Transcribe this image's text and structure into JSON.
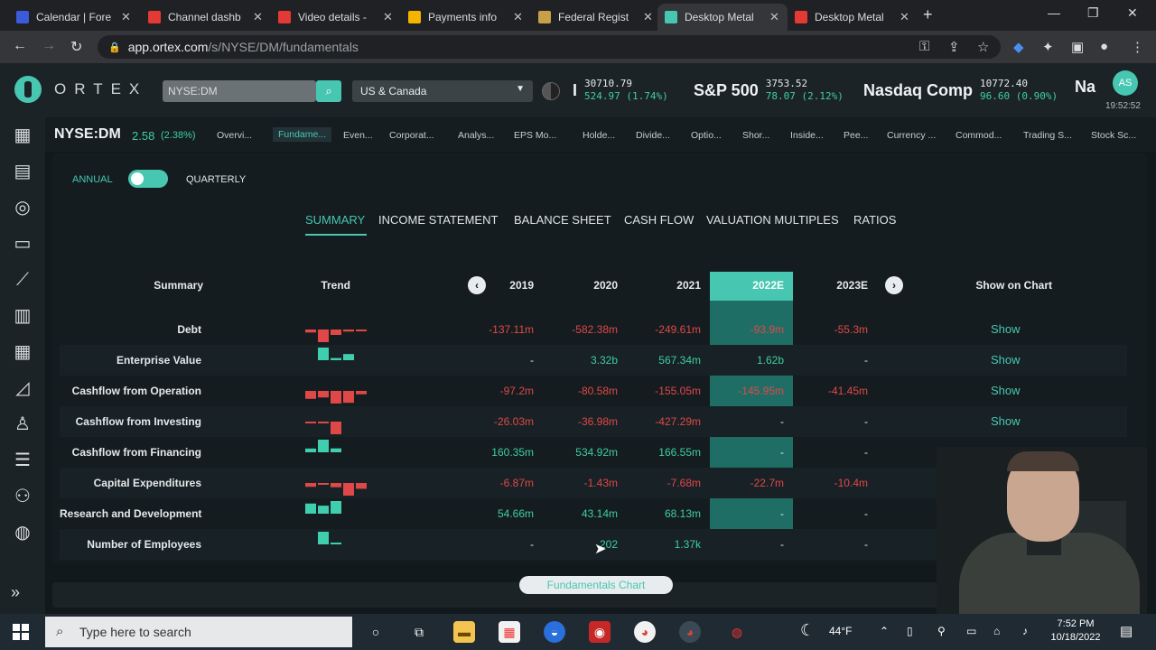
{
  "browser": {
    "tabs": [
      {
        "label": "Calendar | Fore",
        "color": "#3b5bdb"
      },
      {
        "label": "Channel dashb",
        "color": "#e53935"
      },
      {
        "label": "Video details -",
        "color": "#e53935"
      },
      {
        "label": "Payments info",
        "color": "#f4b400"
      },
      {
        "label": "Federal Regist",
        "color": "#c8a04a"
      },
      {
        "label": "Desktop Metal",
        "color": "#47c7b2"
      },
      {
        "label": "Desktop Metal",
        "color": "#e53935"
      }
    ],
    "active_tab": 5,
    "url_host": "app.ortex.com",
    "url_path": "/s/NYSE/DM/fundamentals"
  },
  "header": {
    "logo_text": "ORTEX",
    "search_value": "NYSE:DM",
    "region": "US & Canada",
    "tickers": [
      {
        "name": "I",
        "v1": "30710.79",
        "v2": "524.97 (1.74%)"
      },
      {
        "name": "S&P 500",
        "v1": "3753.52",
        "v2": "78.07 (2.12%)"
      },
      {
        "name": "Nasdaq Comp",
        "v1": "10772.40",
        "v2": "96.60 (0.90%)"
      },
      {
        "name": "Na",
        "v1": "",
        "v2": ""
      }
    ],
    "avatar": "AS",
    "clock": "19:52:52"
  },
  "instrument": {
    "symbol": "NYSE:DM",
    "price": "2.58",
    "change": "(2.38%)",
    "tabs": [
      "Overvi...",
      "Fundame...",
      "Even...",
      "Corporat...",
      "Analys...",
      "EPS Mo...",
      "Holde...",
      "Divide...",
      "Optio...",
      "Shor...",
      "Inside...",
      "Pee...",
      "Currency ...",
      "Commod...",
      "Trading S...",
      "Stock Sc..."
    ]
  },
  "fundamentals": {
    "annual_label": "ANNUAL",
    "quarterly_label": "QUARTERLY",
    "subtabs": [
      "SUMMARY",
      "INCOME STATEMENT",
      "BALANCE SHEET",
      "CASH FLOW",
      "VALUATION MULTIPLES",
      "RATIOS"
    ],
    "col_summary": "Summary",
    "col_trend": "Trend",
    "years": [
      "2019",
      "2020",
      "2021",
      "2022E",
      "2023E"
    ],
    "col_show": "Show on Chart",
    "show_label": "Show",
    "rows": [
      {
        "label": "Debt",
        "values": [
          "-137.11m",
          "-582.38m",
          "-249.61m",
          "-93.9m",
          "-55.3m"
        ],
        "signs": [
          "neg",
          "neg",
          "neg",
          "neg",
          "neg"
        ]
      },
      {
        "label": "Enterprise Value",
        "values": [
          "-",
          "3.32b",
          "567.34m",
          "1.62b",
          "-"
        ],
        "signs": [
          "neu",
          "pos",
          "pos",
          "pos",
          "neu"
        ]
      },
      {
        "label": "Cashflow from Operation",
        "values": [
          "-97.2m",
          "-80.58m",
          "-155.05m",
          "-145.95m",
          "-41.45m"
        ],
        "signs": [
          "neg",
          "neg",
          "neg",
          "neg",
          "neg"
        ]
      },
      {
        "label": "Cashflow from Investing",
        "values": [
          "-26.03m",
          "-36.98m",
          "-427.29m",
          "-",
          "-"
        ],
        "signs": [
          "neg",
          "neg",
          "neg",
          "neu",
          "neu"
        ]
      },
      {
        "label": "Cashflow from Financing",
        "values": [
          "160.35m",
          "534.92m",
          "166.55m",
          "-",
          "-"
        ],
        "signs": [
          "pos",
          "pos",
          "pos",
          "neu",
          "neu"
        ]
      },
      {
        "label": "Capital Expenditures",
        "values": [
          "-6.87m",
          "-1.43m",
          "-7.68m",
          "-22.7m",
          "-10.4m"
        ],
        "signs": [
          "neg",
          "neg",
          "neg",
          "neg",
          "neg"
        ]
      },
      {
        "label": "Research and Development",
        "values": [
          "54.66m",
          "43.14m",
          "68.13m",
          "-",
          "-"
        ],
        "signs": [
          "pos",
          "pos",
          "pos",
          "neu",
          "neu"
        ]
      },
      {
        "label": "Number of Employees",
        "values": [
          "-",
          "202",
          "1.37k",
          "-",
          "-"
        ],
        "signs": [
          "neu",
          "pos",
          "pos",
          "neu",
          "neu"
        ]
      }
    ],
    "chart_button": "Fundamentals Chart"
  },
  "taskbar": {
    "search_placeholder": "Type here to search",
    "weather": "44°F",
    "time": "7:52 PM",
    "date": "10/18/2022"
  }
}
